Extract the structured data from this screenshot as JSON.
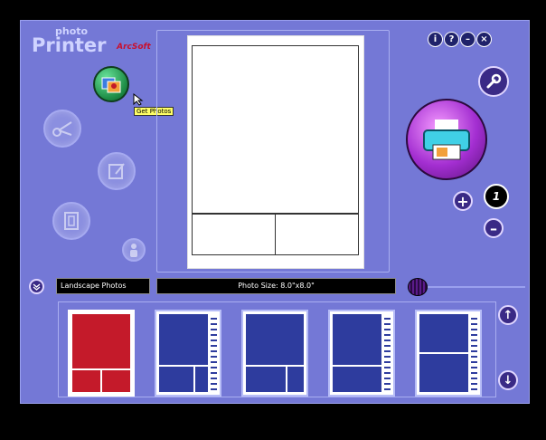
{
  "app": {
    "logo_top": "photo",
    "logo_main": "Printer",
    "logo_brand": "ArcSoft"
  },
  "tooltip": {
    "text": "Get Photos"
  },
  "window_buttons": {
    "info": "i",
    "help": "?",
    "minimize": "–",
    "close": "×"
  },
  "print": {
    "copies": "1",
    "increase": "+",
    "decrease": "–"
  },
  "bottom": {
    "category": "Landscape Photos",
    "photo_size": "Photo Size: 8.0\"x8.0\"",
    "scroll_up": "↑",
    "scroll_down": "↓"
  },
  "colors": {
    "background": "#7478d6",
    "template_blue": "#2e3c9e",
    "template_red": "#c41a2a"
  }
}
